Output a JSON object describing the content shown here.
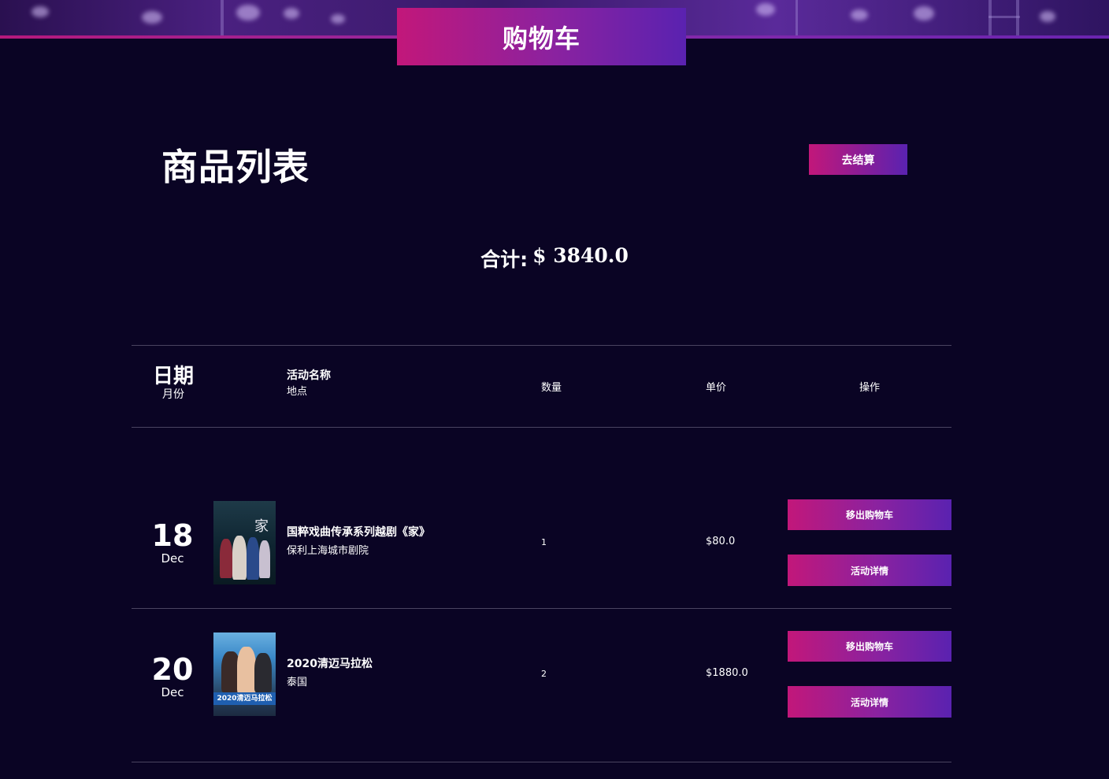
{
  "header": {
    "title": "购物车"
  },
  "main": {
    "heading": "商品列表",
    "checkout_label": "去结算",
    "total_label": "合计:",
    "total_value": "$ 3840.0"
  },
  "table": {
    "headers": {
      "date": "日期",
      "month": "月份",
      "event_name": "活动名称",
      "location": "地点",
      "quantity": "数量",
      "unit_price": "单价",
      "actions": "操作"
    },
    "rows": [
      {
        "day": "18",
        "month": "Dec",
        "name": "国粹戏曲传承系列越剧《家》",
        "place": "保利上海城市剧院",
        "quantity": "1",
        "price": "$80.0",
        "remove_label": "移出购物车",
        "detail_label": "活动详情",
        "thumb_text": "家"
      },
      {
        "day": "20",
        "month": "Dec",
        "name": "2020清迈马拉松",
        "place": "泰国",
        "quantity": "2",
        "price": "$1880.0",
        "remove_label": "移出购物车",
        "detail_label": "活动详情",
        "thumb_text": "2020清迈马拉松"
      }
    ]
  },
  "colors": {
    "background": "#0a0424",
    "accent_start": "#c2177a",
    "accent_end": "#5a22b0"
  }
}
